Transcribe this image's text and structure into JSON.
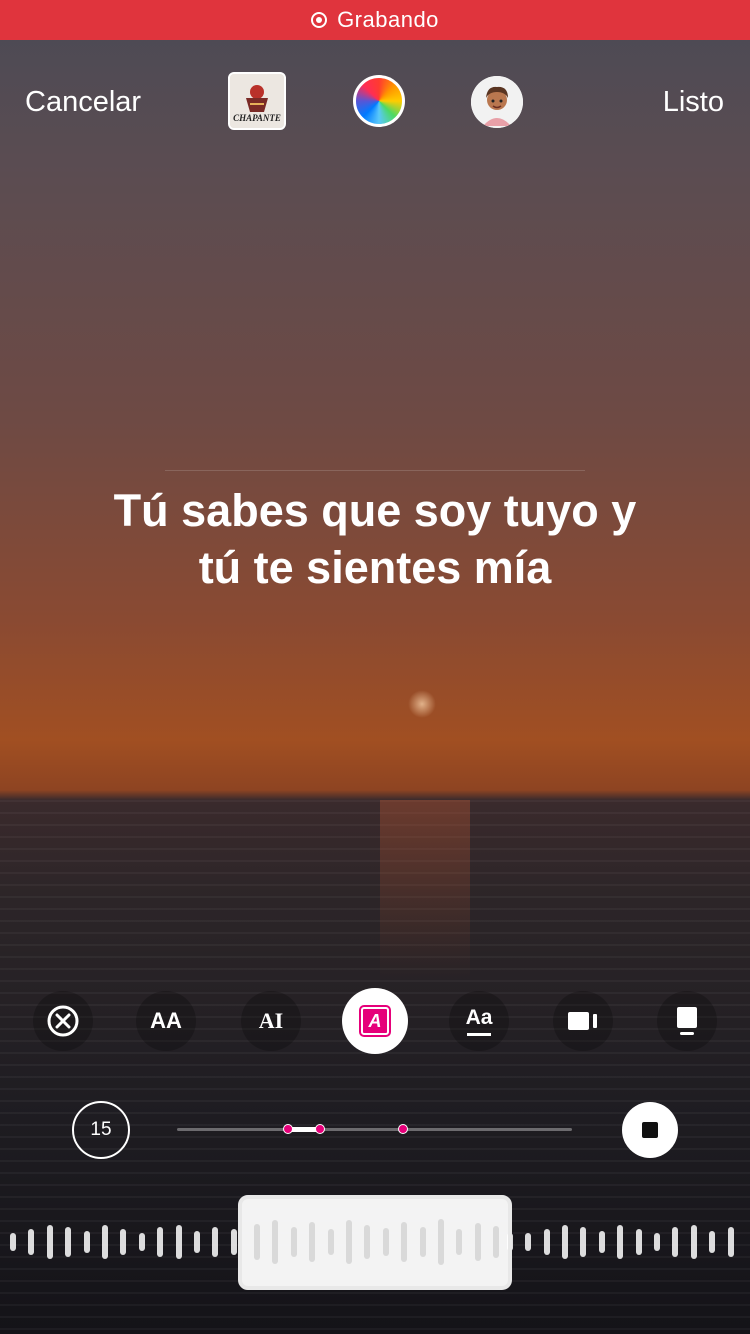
{
  "recording": {
    "label": "Grabando",
    "color": "#e0343d"
  },
  "topbar": {
    "cancel": "Cancelar",
    "done": "Listo",
    "album_art_text": "CHAPANTE"
  },
  "lyrics": {
    "text": "Tú sabes que soy tuyo y tú te sientes mía"
  },
  "toolbar": {
    "items": [
      {
        "name": "remove",
        "icon": "close-circle-icon"
      },
      {
        "name": "font-size",
        "label": "AA",
        "icon": "text-size-icon"
      },
      {
        "name": "typewriter",
        "label": "AI",
        "icon": "typewriter-text-icon"
      },
      {
        "name": "highlight",
        "label": "A",
        "icon": "highlight-text-icon",
        "active": true,
        "color": "#e6007a"
      },
      {
        "name": "underline",
        "label": "Aa",
        "icon": "underline-text-icon"
      },
      {
        "name": "video-clip",
        "icon": "video-icon"
      },
      {
        "name": "card",
        "icon": "card-icon"
      }
    ]
  },
  "timeline": {
    "duration": "15",
    "progress_fraction": 0.31
  },
  "accent_color": "#e6007a"
}
